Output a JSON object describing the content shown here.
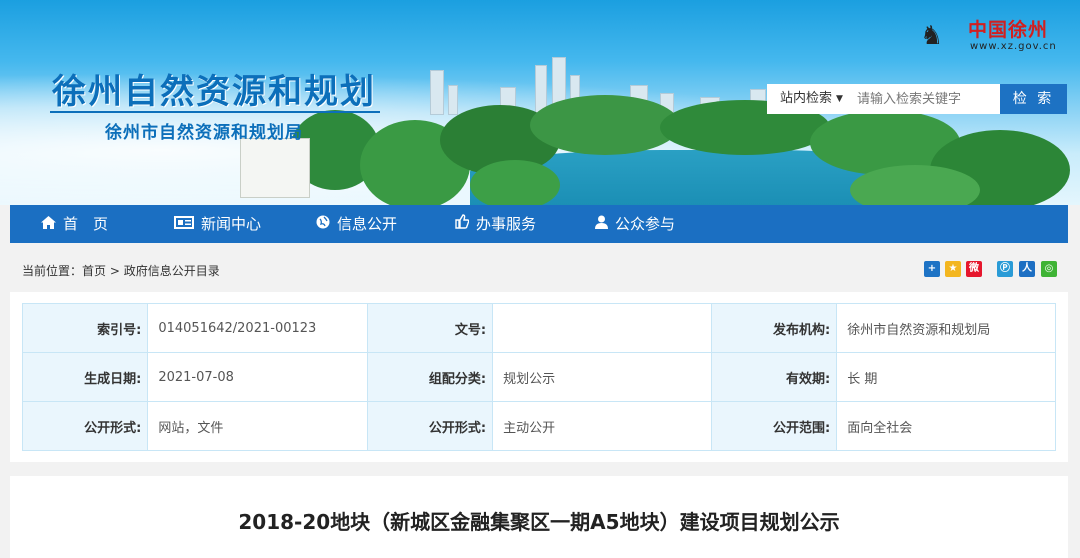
{
  "header": {
    "title": "徐州自然资源和规划",
    "subtitle": "徐州市自然资源和规划局",
    "logo_text": "中国徐州",
    "logo_url": "www.xz.gov.cn"
  },
  "search": {
    "scope_label": "站内检索",
    "placeholder": "请输入检索关键字",
    "button_label": "检 索"
  },
  "nav": {
    "items": [
      {
        "label": "首　页",
        "icon": "home-icon"
      },
      {
        "label": "新闻中心",
        "icon": "news-icon"
      },
      {
        "label": "信息公开",
        "icon": "globe-icon"
      },
      {
        "label": "办事服务",
        "icon": "thumbs-up-icon"
      },
      {
        "label": "公众参与",
        "icon": "user-icon"
      }
    ]
  },
  "breadcrumb": {
    "prefix": "当前位置：",
    "home": "首页",
    "separator": ">",
    "current": "政府信息公开目录"
  },
  "share_icons": [
    "share-plus-icon",
    "qzone-icon",
    "weibo-icon",
    "tencent-weibo-icon",
    "renren-icon",
    "wechat-icon"
  ],
  "info": {
    "rows": [
      [
        {
          "key": "索引号:",
          "value": "014051642/2021-00123"
        },
        {
          "key": "文号:",
          "value": ""
        },
        {
          "key": "发布机构:",
          "value": "徐州市自然资源和规划局"
        }
      ],
      [
        {
          "key": "生成日期:",
          "value": "2021-07-08"
        },
        {
          "key": "组配分类:",
          "value": "规划公示"
        },
        {
          "key": "有效期:",
          "value": "长 期"
        }
      ],
      [
        {
          "key": "公开形式:",
          "value": "网站，文件"
        },
        {
          "key": "公开形式:",
          "value": "主动公开"
        },
        {
          "key": "公开范围:",
          "value": "面向全社会"
        }
      ]
    ]
  },
  "article": {
    "title": "2018-20地块（新城区金融集聚区一期A5地块）建设项目规划公示"
  },
  "colors": {
    "nav_bg": "#1b6fc2",
    "title_blue": "#0c6fba",
    "table_border": "#c8e6f6",
    "table_key_bg": "#eaf6fd"
  }
}
